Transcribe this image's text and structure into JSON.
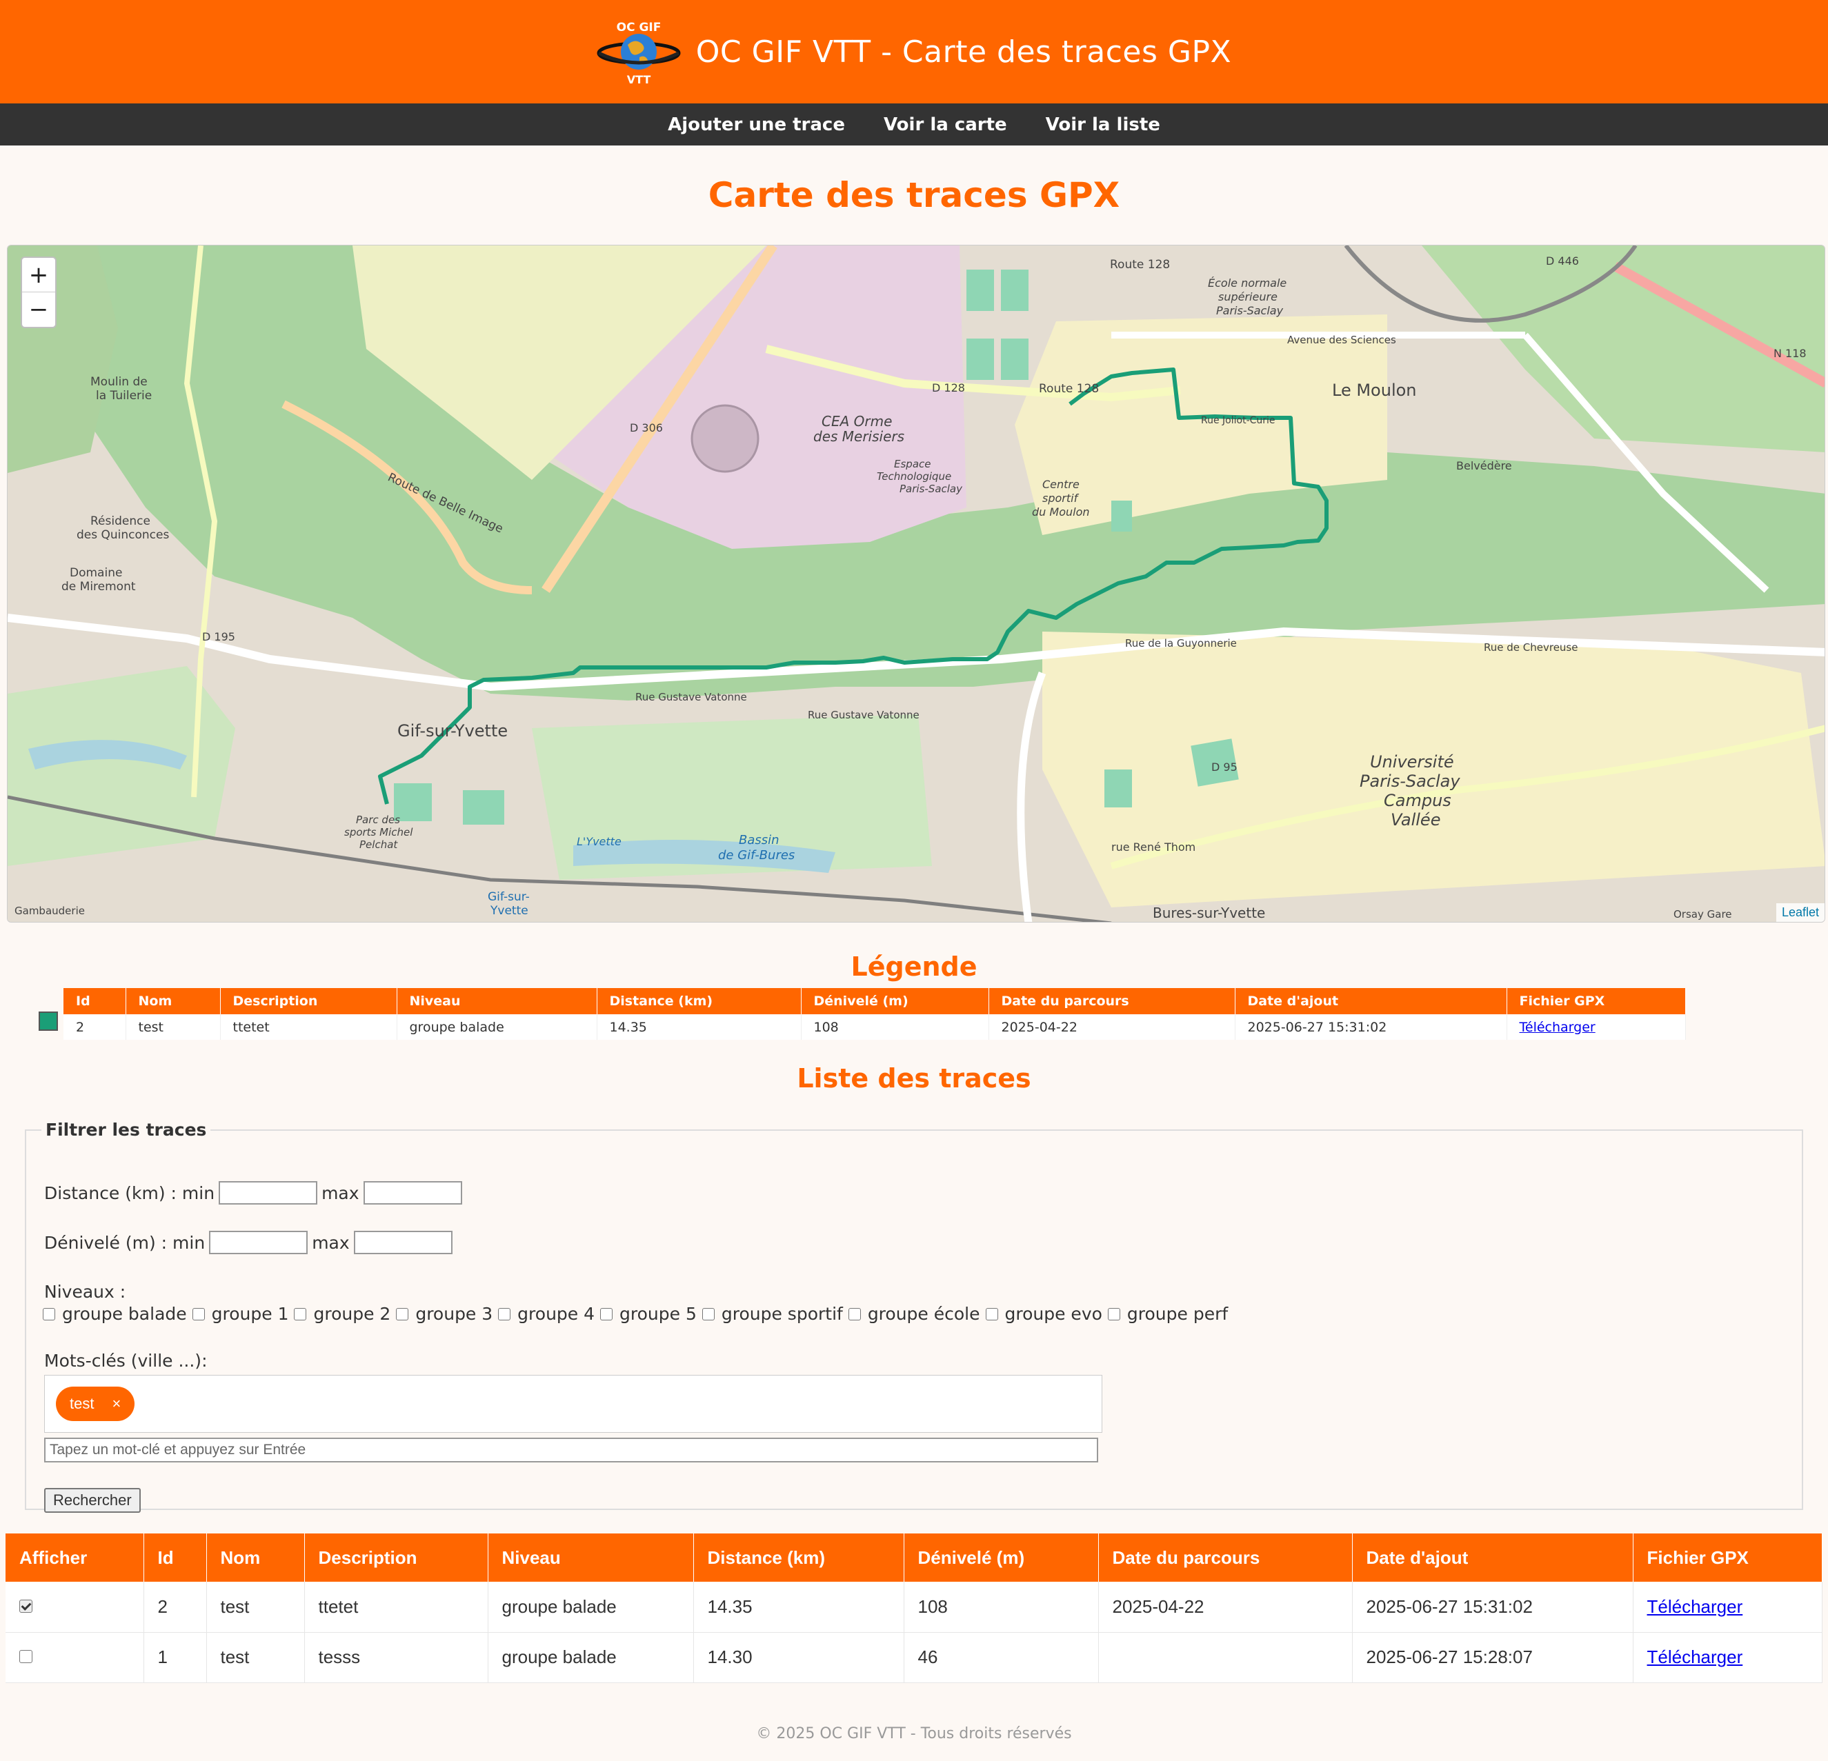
{
  "header": {
    "title": "OC GIF VTT - Carte des traces GPX",
    "logo_top": "OC GIF",
    "logo_bottom": "VTT"
  },
  "nav": {
    "items": [
      "Ajouter une trace",
      "Voir la carte",
      "Voir la liste"
    ]
  },
  "page_title": "Carte des traces GPX",
  "map": {
    "zoom_in": "+",
    "zoom_out": "−",
    "attribution": "Leaflet",
    "trace_color": "#1a9e77",
    "labels": {
      "gif": "Gif-sur-Yvette",
      "moulon": "Le Moulon",
      "cea1": "CEA Orme",
      "cea2": "des Merisiers",
      "route128": "Route 128",
      "d306": "D 306",
      "d195": "D 195",
      "d95": "D 95",
      "d128": "D 128",
      "n118": "N 118",
      "d446": "D 446",
      "ens1": "École normale",
      "ens2": "supérieure",
      "ens3": "Paris-Saclay",
      "avsci": "Avenue des Sciences",
      "guyonnerie": "Rue de la Guyonnerie",
      "chevreuse": "Rue de Chevreuse",
      "vatonne": "Rue Gustave Vatonne",
      "belleimage": "Route de Belle Image",
      "ups1": "Université",
      "ups2": "Paris-Saclay",
      "ups3": "Campus",
      "ups4": "Vallée",
      "bures1": "Bassin",
      "bures2": "de Gif-Bures",
      "miromont1": "Domaine",
      "miromont2": "de Miremont",
      "quinc1": "Résidence",
      "quinc2": "des Quinconces",
      "tuilerie1": "Moulin de",
      "tuilerie2": "la Tuilerie",
      "csm1": "Centre",
      "csm2": "sportif",
      "csm3": "du Moulon",
      "orsaygare": "Orsay Gare",
      "belvedere": "Belvédère",
      "burespark": "Bures-sur-Yvette",
      "joliot": "Rue Joliot-Curie",
      "renethom": "rue René Thom",
      "parc1": "Parc des",
      "parc2": "sports Michel",
      "parc3": "Pelchat",
      "yvette": "L'Yvette",
      "gifstation1": "Gif-sur-",
      "gifstation2": "Yvette",
      "gamb": "Gambauderie",
      "espace1": "Espace",
      "espace2": "Technologique",
      "espace3": "Paris-Saclay"
    }
  },
  "legend": {
    "title": "Légende",
    "color": "#1a9e77",
    "headers": [
      "Id",
      "Nom",
      "Description",
      "Niveau",
      "Distance (km)",
      "Dénivelé (m)",
      "Date du parcours",
      "Date d'ajout",
      "Fichier GPX"
    ],
    "row": {
      "id": "2",
      "nom": "test",
      "description": "ttetet",
      "niveau": "groupe balade",
      "distance": "14.35",
      "denivele": "108",
      "date_parcours": "2025-04-22",
      "date_ajout": "2025-06-27 15:31:02",
      "fichier": "Télécharger"
    }
  },
  "list_title": "Liste des traces",
  "filter": {
    "legend": "Filtrer les traces",
    "distance_label": "Distance (km) : min",
    "elevation_label": "Dénivelé (m) : min",
    "max_label": "max",
    "levels_label": "Niveaux :",
    "levels": [
      "groupe balade",
      "groupe 1",
      "groupe 2",
      "groupe 3",
      "groupe 4",
      "groupe 5",
      "groupe sportif",
      "groupe école",
      "groupe evo",
      "groupe perf"
    ],
    "keywords_label": "Mots-clés (ville ...):",
    "tag": "test",
    "tag_remove": "×",
    "keyword_placeholder": "Tapez un mot-clé et appuyez sur Entrée",
    "search_button": "Rechercher"
  },
  "table": {
    "headers": [
      "Afficher",
      "Id",
      "Nom",
      "Description",
      "Niveau",
      "Distance (km)",
      "Dénivelé (m)",
      "Date du parcours",
      "Date d'ajout",
      "Fichier GPX"
    ],
    "rows": [
      {
        "checked": true,
        "id": "2",
        "nom": "test",
        "description": "ttetet",
        "niveau": "groupe balade",
        "distance": "14.35",
        "denivele": "108",
        "date_parcours": "2025-04-22",
        "date_ajout": "2025-06-27 15:31:02",
        "fichier": "Télécharger"
      },
      {
        "checked": false,
        "id": "1",
        "nom": "test",
        "description": "tesss",
        "niveau": "groupe balade",
        "distance": "14.30",
        "denivele": "46",
        "date_parcours": "",
        "date_ajout": "2025-06-27 15:28:07",
        "fichier": "Télécharger"
      }
    ]
  },
  "footer": "© 2025 OC GIF VTT - Tous droits réservés"
}
